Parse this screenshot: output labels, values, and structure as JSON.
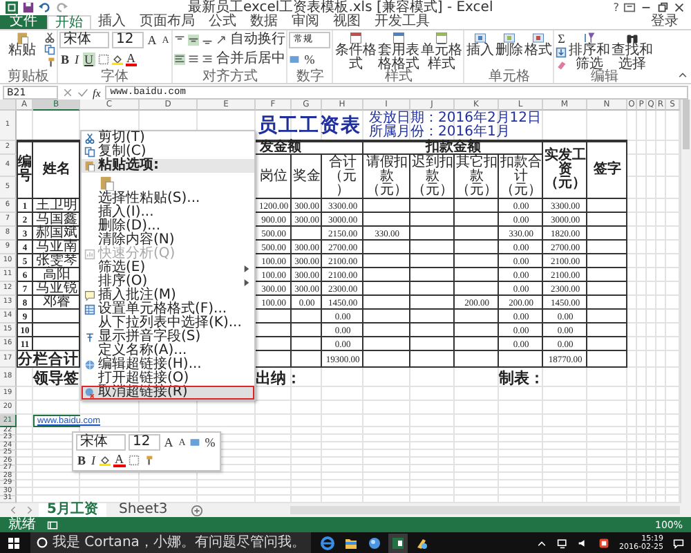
{
  "window": {
    "title": "最新员工excel工资表模板.xls [兼容模式] - Excel",
    "help": "?"
  },
  "tabs": [
    {
      "label": "文件",
      "kind": "file",
      "selected": false
    },
    {
      "label": "开始",
      "kind": "tab",
      "selected": true
    },
    {
      "label": "插入",
      "kind": "tab",
      "selected": false
    },
    {
      "label": "页面布局",
      "kind": "tab",
      "selected": false
    },
    {
      "label": "公式",
      "kind": "tab",
      "selected": false
    },
    {
      "label": "数据",
      "kind": "tab",
      "selected": false
    },
    {
      "label": "审阅",
      "kind": "tab",
      "selected": false
    },
    {
      "label": "视图",
      "kind": "tab",
      "selected": false
    },
    {
      "label": "开发工具",
      "kind": "tab",
      "selected": false
    }
  ],
  "account": "登录",
  "ribbon": {
    "clipboard": {
      "label": "剪贴板",
      "paste": "粘贴"
    },
    "font": {
      "label": "字体",
      "family": "宋体",
      "size": "12",
      "grow": "A",
      "shrink": "A",
      "bold": "B",
      "italic": "I",
      "underline": {
        "label": "U",
        "selected": true
      },
      "tint": "A"
    },
    "alignment": {
      "label": "对齐方式",
      "vertical": [
        {
          "selected": false
        },
        {
          "selected": true
        },
        {
          "selected": false
        }
      ],
      "horizontal": [
        {
          "selected": true
        },
        {
          "selected": false
        },
        {
          "selected": false
        }
      ],
      "wrap": "自动换行",
      "merge": "合并后居中"
    },
    "number": {
      "label": "数字",
      "format": "常规",
      "percent": "%"
    },
    "styles": {
      "label": "样式",
      "buttons": [
        "条件格式",
        "套用表格格式",
        "单元格样式"
      ]
    },
    "cells": {
      "label": "单元格",
      "buttons": [
        "插入",
        "删除",
        "格式"
      ]
    },
    "editing": {
      "label": "编辑",
      "sum": "Σ",
      "buttons": [
        "排序和筛选",
        "查找和选择"
      ]
    }
  },
  "formula_bar": {
    "name_box": "B21",
    "fx": "fx",
    "value": "www.baidu.com"
  },
  "sheet": {
    "columns": [
      {
        "label": "A",
        "selected": false
      },
      {
        "label": "B",
        "selected": true
      },
      {
        "label": "C",
        "selected": false
      },
      {
        "label": "D",
        "selected": false
      },
      {
        "label": "E",
        "selected": false
      },
      {
        "label": "F",
        "selected": false
      },
      {
        "label": "G",
        "selected": false
      },
      {
        "label": "H",
        "selected": false
      },
      {
        "label": "I",
        "selected": false
      },
      {
        "label": "J",
        "selected": false
      },
      {
        "label": "K",
        "selected": false
      },
      {
        "label": "L",
        "selected": false
      },
      {
        "label": "M",
        "selected": false
      },
      {
        "label": "N",
        "selected": false
      },
      {
        "label": "O",
        "selected": false
      },
      {
        "label": "P",
        "selected": false
      },
      {
        "label": "Q",
        "selected": false
      },
      {
        "label": "R",
        "selected": false
      },
      {
        "label": "S",
        "selected": false
      }
    ],
    "row_headers": [
      {
        "label": "1",
        "selected": false
      },
      {
        "label": "2",
        "selected": false
      },
      {
        "label": "4",
        "selected": false
      },
      {
        "label": "5",
        "selected": false
      },
      {
        "label": "6",
        "selected": false
      },
      {
        "label": "7",
        "selected": false
      },
      {
        "label": "8",
        "selected": false
      },
      {
        "label": "9",
        "selected": false
      },
      {
        "label": "10",
        "selected": false
      },
      {
        "label": "11",
        "selected": false
      },
      {
        "label": "12",
        "selected": false
      },
      {
        "label": "13",
        "selected": false
      },
      {
        "label": "14",
        "selected": false
      },
      {
        "label": "15",
        "selected": false
      },
      {
        "label": "16",
        "selected": false
      },
      {
        "label": "17",
        "selected": false
      },
      {
        "label": "18",
        "selected": false
      },
      {
        "label": "19",
        "selected": false
      },
      {
        "label": "20",
        "selected": false
      },
      {
        "label": "21",
        "selected": true
      },
      {
        "label": "22",
        "selected": false
      },
      {
        "label": "23",
        "selected": false
      },
      {
        "label": "24",
        "selected": false
      },
      {
        "label": "25",
        "selected": false
      },
      {
        "label": "26",
        "selected": false
      },
      {
        "label": "27",
        "selected": false
      },
      {
        "label": "28",
        "selected": false
      },
      {
        "label": "29",
        "selected": false
      },
      {
        "label": "30",
        "selected": false
      },
      {
        "label": "31",
        "selected": false
      }
    ],
    "title": "员工工资表",
    "issue_date": "发放日期：2016年2月12日",
    "month": "所属月份：2016年1月",
    "group_headers": [
      "发金额",
      "扣款金额"
    ],
    "headers": [
      "编号",
      "姓名",
      "岗位",
      "奖金",
      "合计（元）",
      "请假扣款（元）",
      "迟到扣款（元）",
      "其它扣款（元）",
      "扣款合计（元）",
      "实发工资（元）",
      "签字"
    ],
    "employees": [
      {
        "no": "1",
        "name": "王卫明",
        "values": {
          "F": "1200.00",
          "G": "300.00",
          "H": "3300.00",
          "L": "0.00",
          "M": "3300.00"
        }
      },
      {
        "no": "2",
        "name": "马国鑫",
        "values": {
          "F": "900.00",
          "G": "300.00",
          "H": "3000.00",
          "L": "0.00",
          "M": "3000.00"
        }
      },
      {
        "no": "3",
        "name": "郝国斌",
        "values": {
          "F": "500.00",
          "H": "2150.00",
          "I": "330.00",
          "L": "330.00",
          "M": "1820.00"
        }
      },
      {
        "no": "4",
        "name": "马亚南",
        "values": {
          "F": "500.00",
          "G": "300.00",
          "H": "2700.00",
          "L": "0.00",
          "M": "2700.00"
        }
      },
      {
        "no": "5",
        "name": "张雯琴",
        "values": {
          "F": "100.00",
          "G": "300.00",
          "H": "2100.00",
          "L": "0.00",
          "M": "2100.00"
        }
      },
      {
        "no": "6",
        "name": "高阳",
        "values": {
          "F": "100.00",
          "G": "300.00",
          "H": "2100.00",
          "L": "0.00",
          "M": "2100.00"
        }
      },
      {
        "no": "7",
        "name": "马亚锐",
        "values": {
          "F": "300.00",
          "G": "300.00",
          "H": "2300.00",
          "L": "0.00",
          "M": "2300.00"
        }
      },
      {
        "no": "8",
        "name": "邓睿",
        "values": {
          "F": "100.00",
          "G": "0.00",
          "H": "1450.00",
          "K": "200.00",
          "L": "200.00",
          "M": "1450.00"
        }
      },
      {
        "no": "9",
        "values": {
          "H": "0.00",
          "L": "0.00",
          "M": "0.00"
        }
      },
      {
        "no": "10",
        "values": {
          "H": "0.00",
          "L": "0.00",
          "M": "0.00"
        }
      },
      {
        "no": "11",
        "values": {
          "H": "0.00",
          "L": "0.00",
          "M": "0.00"
        }
      }
    ],
    "total": {
      "label": "分栏合计",
      "values": {
        "H": "19300.00",
        "M": "18770.00"
      }
    },
    "signatures": [
      "领导签",
      "出纳：",
      "制表："
    ],
    "link": "www.baidu.com"
  },
  "context_menu": [
    {
      "label": "剪切(T)",
      "kind": "item",
      "disabled": false,
      "selected": false
    },
    {
      "label": "复制(C)",
      "kind": "item",
      "disabled": false,
      "selected": false
    },
    {
      "label": "粘贴选项:",
      "kind": "header",
      "disabled": false,
      "selected": false
    },
    {
      "kind": "paste-icons",
      "disabled": false,
      "selected": false
    },
    {
      "label": "选择性粘贴(S)...",
      "kind": "item",
      "disabled": false,
      "selected": false
    },
    {
      "label": "插入(I)...",
      "kind": "item",
      "disabled": false,
      "selected": false
    },
    {
      "label": "删除(D)...",
      "kind": "item",
      "disabled": false,
      "selected": false
    },
    {
      "label": "清除内容(N)",
      "kind": "item",
      "disabled": false,
      "selected": false
    },
    {
      "label": "快速分析(Q)",
      "kind": "item",
      "disabled": true,
      "selected": false
    },
    {
      "label": "筛选(E)",
      "kind": "item",
      "disabled": false,
      "submenu": true,
      "selected": false
    },
    {
      "label": "排序(O)",
      "kind": "item",
      "disabled": false,
      "submenu": true,
      "selected": false
    },
    {
      "label": "插入批注(M)",
      "kind": "item",
      "disabled": false,
      "selected": false
    },
    {
      "label": "设置单元格格式(F)...",
      "kind": "item",
      "disabled": false,
      "selected": false
    },
    {
      "label": "从下拉列表中选择(K)...",
      "kind": "item",
      "disabled": false,
      "selected": false
    },
    {
      "label": "显示拼音字段(S)",
      "kind": "item",
      "disabled": false,
      "selected": false
    },
    {
      "label": "定义名称(A)...",
      "kind": "item",
      "disabled": false,
      "selected": false
    },
    {
      "label": "编辑超链接(H)...",
      "kind": "item",
      "disabled": false,
      "selected": false
    },
    {
      "label": "打开超链接(O)",
      "kind": "item",
      "disabled": false,
      "selected": false
    },
    {
      "label": "取消超链接(R)",
      "kind": "item",
      "disabled": false,
      "selected": true
    }
  ],
  "mini_toolbar": {
    "family": "宋体",
    "size": "12",
    "grow": "A",
    "shrink": "A",
    "percent": "%",
    "bold": "B",
    "italic": "I",
    "tint": "A"
  },
  "sheet_tabs": [
    {
      "label": "5月工资",
      "selected": true
    },
    {
      "label": "Sheet3",
      "selected": false
    }
  ],
  "status_bar": {
    "status": "就绪",
    "zoom": "100%"
  },
  "taskbar": {
    "search_hint": "我是 Cortana，小娜。有问题尽管问我。",
    "time": "15:19",
    "date": "2016-02-25"
  }
}
